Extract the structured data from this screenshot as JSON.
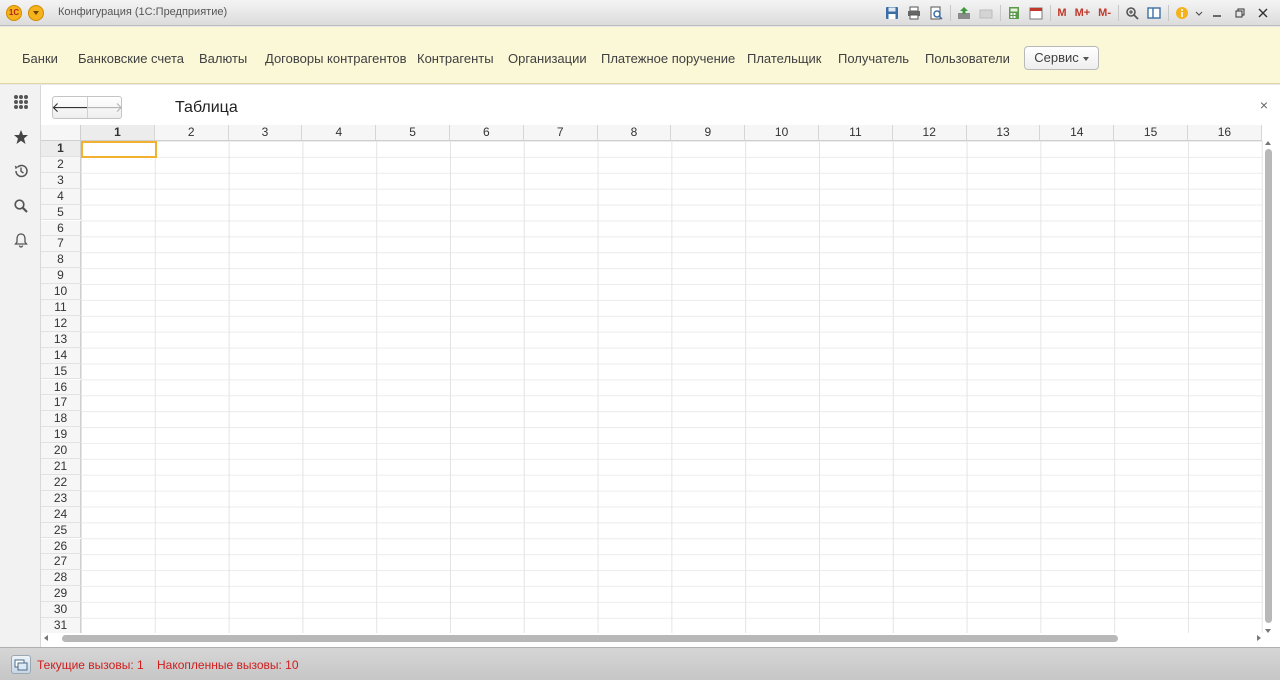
{
  "window": {
    "logo_text": "1С",
    "title": "Конфигурация  (1С:Предприятие)",
    "toolbar_text_buttons": [
      "M",
      "M+",
      "M-"
    ]
  },
  "sections": {
    "items": [
      {
        "label": "Банки"
      },
      {
        "label": "Банковские счета"
      },
      {
        "label": "Валюты"
      },
      {
        "label": "Договоры контрагентов"
      },
      {
        "label": "Контрагенты"
      },
      {
        "label": "Организации"
      },
      {
        "label": "Платежное поручение"
      },
      {
        "label": "Плательщик"
      },
      {
        "label": "Получатель"
      },
      {
        "label": "Пользователи"
      }
    ],
    "service_label": "Сервис"
  },
  "form": {
    "back_glyph": "🡐",
    "forward_glyph": "🡒",
    "title": "Таблица",
    "close_glyph": "×"
  },
  "sheet": {
    "columns": [
      "1",
      "2",
      "3",
      "4",
      "5",
      "6",
      "7",
      "8",
      "9",
      "10",
      "11",
      "12",
      "13",
      "14",
      "15",
      "16"
    ],
    "rows": [
      "1",
      "2",
      "3",
      "4",
      "5",
      "6",
      "7",
      "8",
      "9",
      "10",
      "11",
      "12",
      "13",
      "14",
      "15",
      "16",
      "17",
      "18",
      "19",
      "20",
      "21",
      "22",
      "23",
      "24",
      "25",
      "26",
      "27",
      "28",
      "29",
      "30",
      "31"
    ],
    "active_column": "1",
    "active_row": "1"
  },
  "status": {
    "current_calls": "Текущие вызовы: 1",
    "accumulated_calls": "Накопленные вызовы: 10"
  },
  "colors": {
    "section_panel_bg": "#fbf8d8",
    "active_cell_border": "#f2b130",
    "status_text": "#d01c1c",
    "logo_bg": "#f5b21b"
  }
}
